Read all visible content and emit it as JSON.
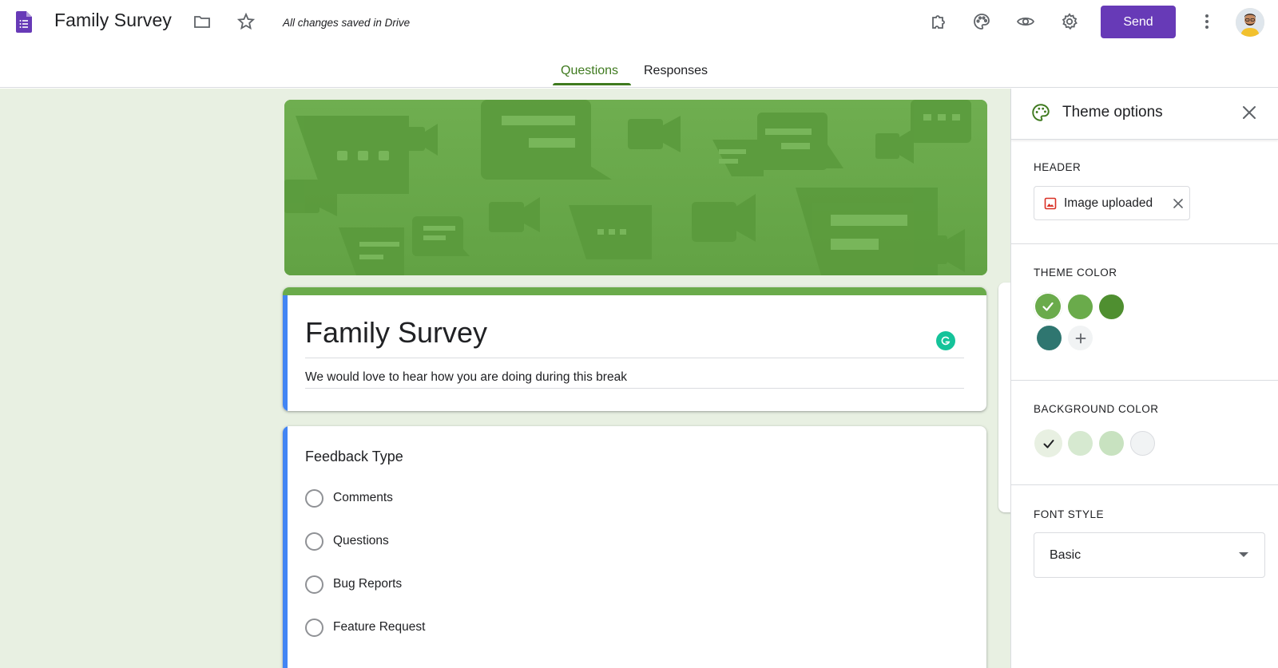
{
  "app": {
    "title": "Family Survey",
    "save_status": "All changes saved in Drive",
    "send_label": "Send",
    "icons": [
      "forms-logo-icon",
      "folder-icon",
      "star-icon",
      "addon-puzzle-icon",
      "palette-icon",
      "preview-eye-icon",
      "settings-gear-icon",
      "more-vert-icon"
    ]
  },
  "tabs": [
    {
      "label": "Questions",
      "active": true
    },
    {
      "label": "Responses",
      "active": false
    }
  ],
  "form": {
    "title": "Family Survey",
    "description": "We would love to hear how you are doing during this break"
  },
  "question": {
    "title": "Feedback Type",
    "options": [
      "Comments",
      "Questions",
      "Bug Reports",
      "Feature Request"
    ]
  },
  "theme_panel": {
    "title": "Theme options",
    "header_label": "HEADER",
    "header_chip": "Image uploaded",
    "theme_color_label": "THEME COLOR",
    "theme_colors": [
      "#6aab4b",
      "#6aab4b",
      "#4f8f30",
      "#2f7670"
    ],
    "theme_selected": 0,
    "background_color_label": "BACKGROUND COLOR",
    "background_colors": [
      "#e8f0e2",
      "#d6e9d0",
      "#c8e2c0",
      "#f1f3f4"
    ],
    "background_selected": 0,
    "font_style_label": "FONT STYLE",
    "font_style_value": "Basic"
  },
  "colors": {
    "accent_purple": "#673ab7",
    "accent_green": "#3f7a1f",
    "header_green": "#6aab4b",
    "title_left_band": "#4285f4"
  }
}
